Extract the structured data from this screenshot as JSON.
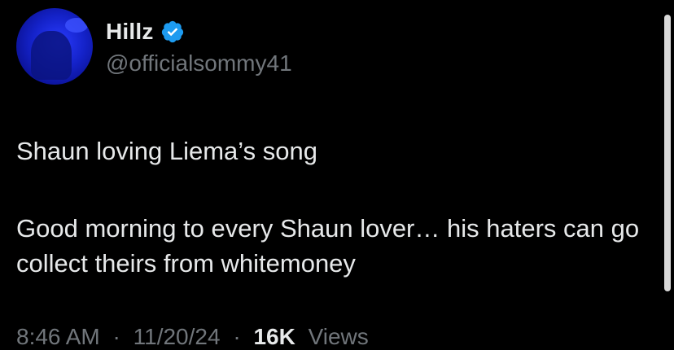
{
  "author": {
    "display_name": "Hillz",
    "handle": "@officialsommy41",
    "verified": true,
    "avatar_icon": "profile-avatar"
  },
  "tweet": {
    "line1": "Shaun loving Liema’s song",
    "line2": "Good morning to every Shaun lover… his haters can go collect theirs from whitemoney"
  },
  "meta": {
    "time": "8:46 AM",
    "separator": "·",
    "date": "11/20/24",
    "views_count": "16K",
    "views_label": "Views"
  },
  "colors": {
    "background": "#000000",
    "primary_text": "#e7e9ea",
    "secondary_text": "#71767b",
    "verified_blue": "#1d9bf0"
  }
}
